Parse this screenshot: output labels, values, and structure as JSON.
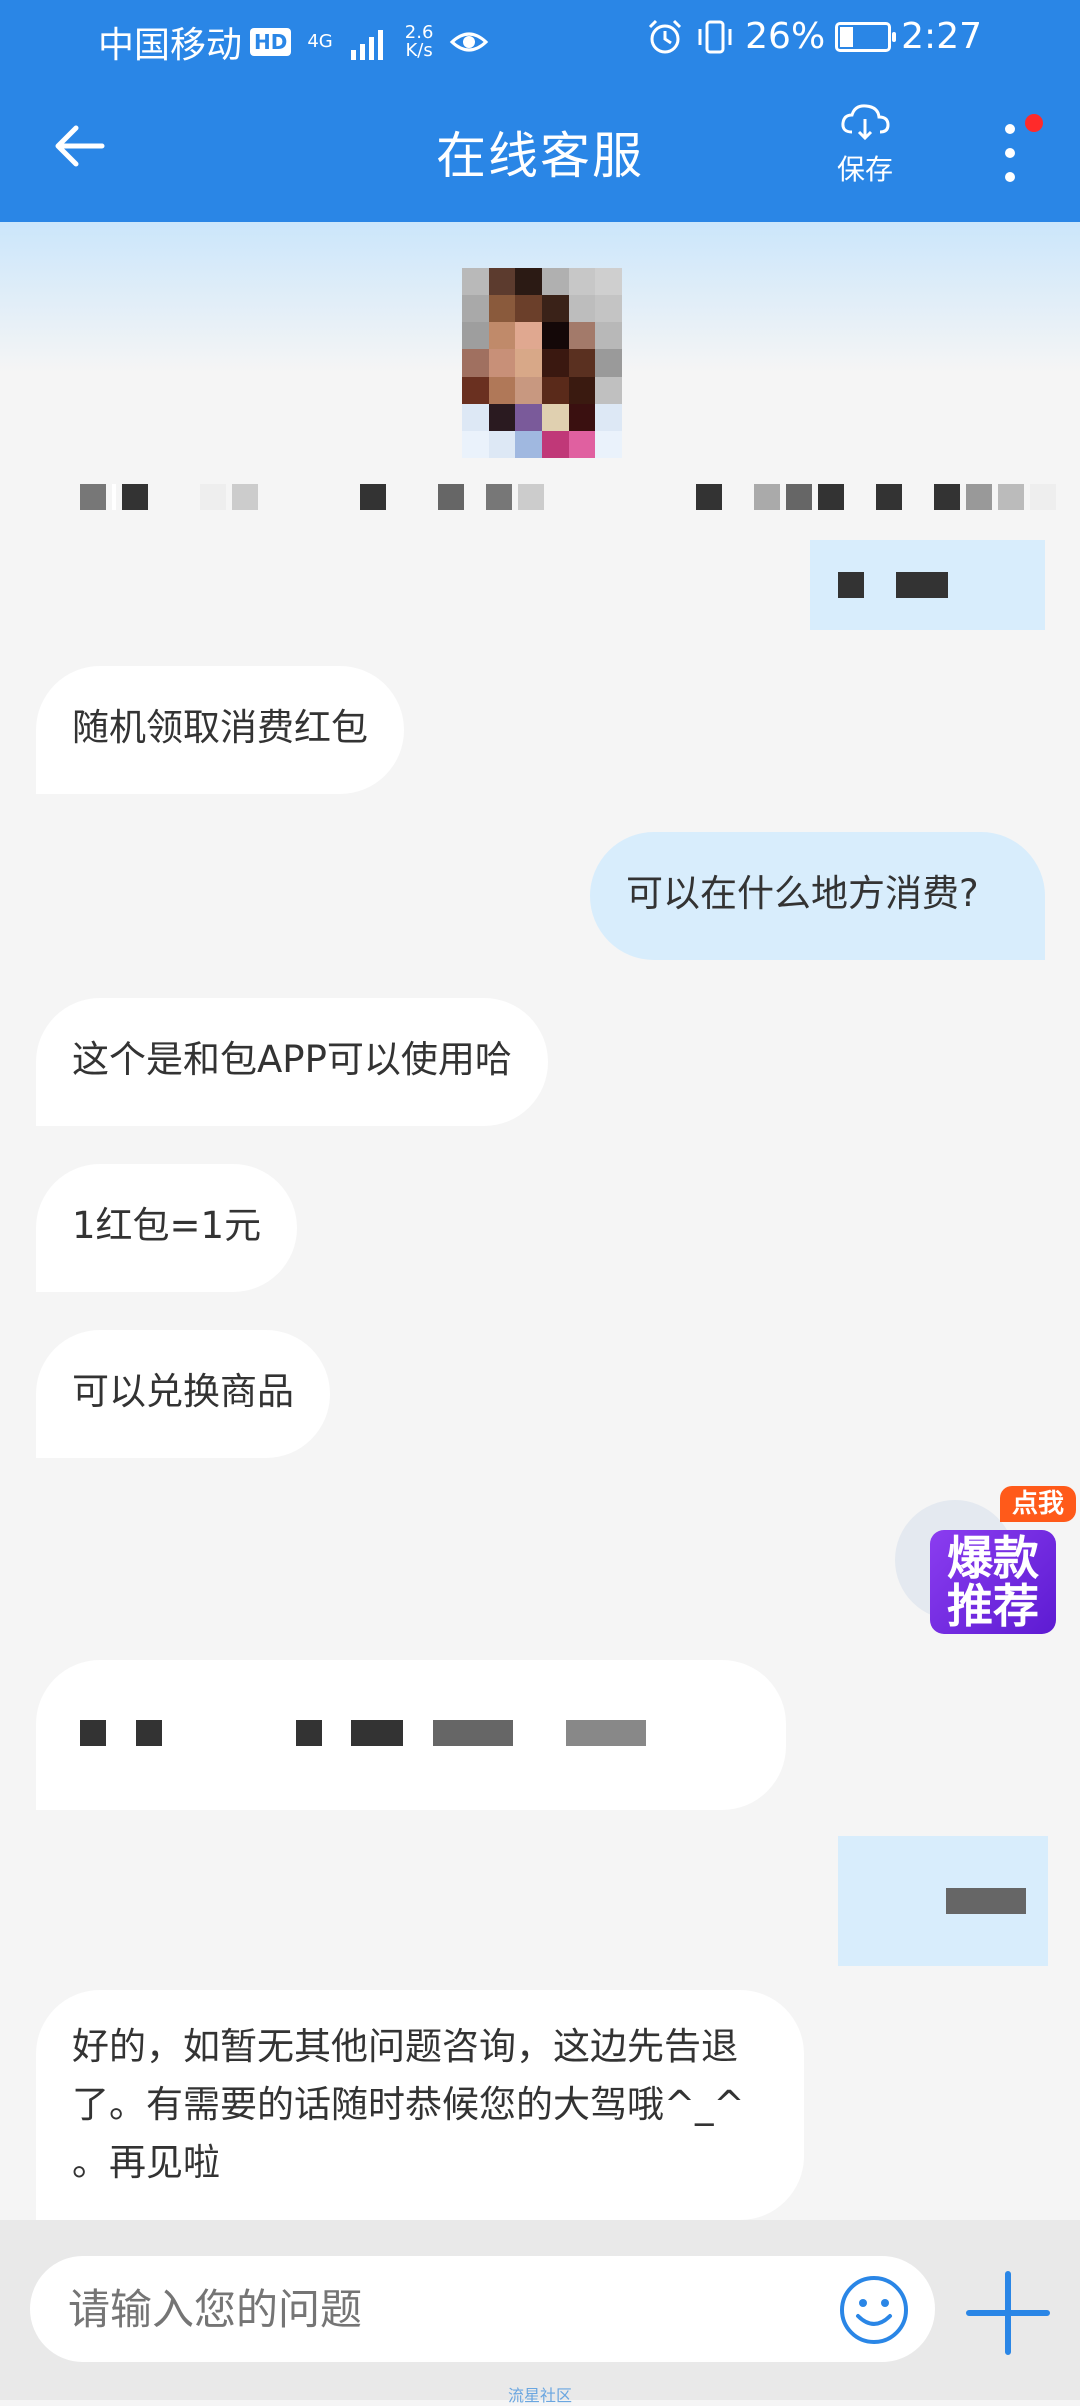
{
  "status_bar": {
    "carrier": "中国移动",
    "hd": "HD",
    "net_type": "4G",
    "speed_value": "2.6",
    "speed_unit": "K/s",
    "battery": "26%",
    "time": "2:27"
  },
  "header": {
    "title": "在线客服",
    "save_label": "保存",
    "back_icon": "arrow-left-icon",
    "save_icon": "cloud-download-icon",
    "more_icon": "more-vertical-icon",
    "notification_dot_color": "#ff2a2a"
  },
  "messages": [
    {
      "side": "left",
      "text": "随机领取消费红包"
    },
    {
      "side": "right",
      "text": "可以在什么地方消费?"
    },
    {
      "side": "left",
      "text": "这个是和包APP可以使用哈"
    },
    {
      "side": "left",
      "text": "1红包=1元"
    },
    {
      "side": "left",
      "text": "可以兑换商品"
    },
    {
      "side": "left",
      "text": "好的，如暂无其他问题咨询，这边先告退了。有需要的话随时恭候您的大驾哦^_^ 。再见啦"
    }
  ],
  "promo": {
    "tag": "点我",
    "line1": "爆款",
    "line2": "推荐"
  },
  "input": {
    "placeholder": "请输入您的问题",
    "emoji_icon": "smiley-icon",
    "plus_icon": "plus-icon"
  },
  "watermark": "流星社区",
  "colors": {
    "header_bg": "#2a86e6",
    "bubble_left": "#ffffff",
    "bubble_right": "#d8edfc",
    "accent": "#2a86e6"
  }
}
